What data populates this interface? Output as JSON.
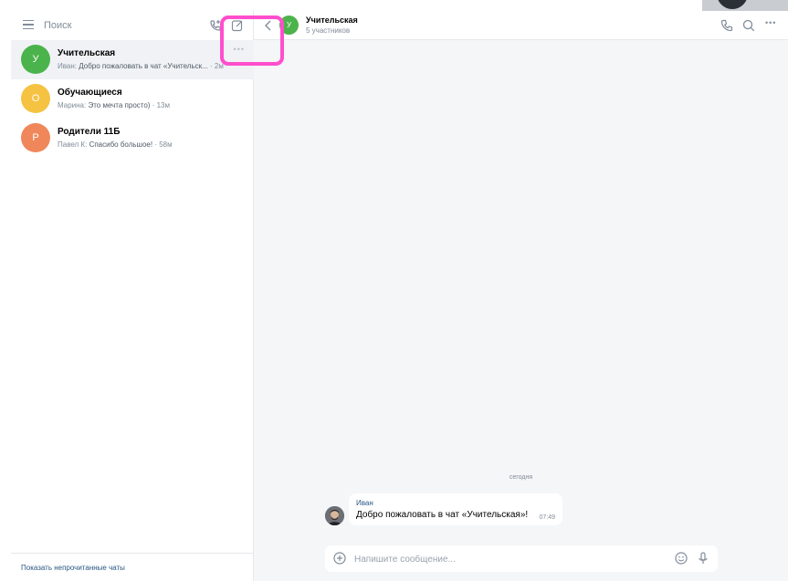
{
  "sidebar": {
    "search_placeholder": "Поиск",
    "chats": [
      {
        "avatar_letter": "У",
        "avatar_color": "#4bb34b",
        "title": "Учительская",
        "sender": "Иван:",
        "preview": "Добро пожаловать в чат «Учительск...",
        "time": "· 2м",
        "active": true
      },
      {
        "avatar_letter": "О",
        "avatar_color": "#f5c242",
        "title": "Обучающиеся",
        "sender": "Марина:",
        "preview": "Это мечта просто)",
        "time": "· 13м",
        "active": false
      },
      {
        "avatar_letter": "Р",
        "avatar_color": "#f0875a",
        "title": "Родители 11Б",
        "sender": "Павел К:",
        "preview": "Спасибо большое!",
        "time": "· 58м",
        "active": false
      }
    ],
    "more_dots": "•••",
    "show_unread": "Показать непрочитанные чаты"
  },
  "chat": {
    "avatar_letter": "У",
    "title": "Учительская",
    "subtitle": "5 участников",
    "more_dots": "•••",
    "date_divider": "сегодня",
    "message": {
      "author": "Иван",
      "text": "Добро пожаловать в чат «Учительская»!",
      "time": "07:49"
    },
    "composer_placeholder": "Напишите сообщение..."
  },
  "colors": {
    "accent": "#2a5885",
    "highlight": "#ff4ecd",
    "icon": "#818c99"
  },
  "icons": {
    "menu": "hamburger-icon",
    "new_call": "phone-plus-icon",
    "compose": "compose-icon",
    "back": "chevron-left-icon",
    "call": "phone-icon",
    "search": "search-icon",
    "more": "more-icon",
    "attach": "plus-circle-icon",
    "emoji": "emoji-icon",
    "voice": "microphone-icon"
  }
}
